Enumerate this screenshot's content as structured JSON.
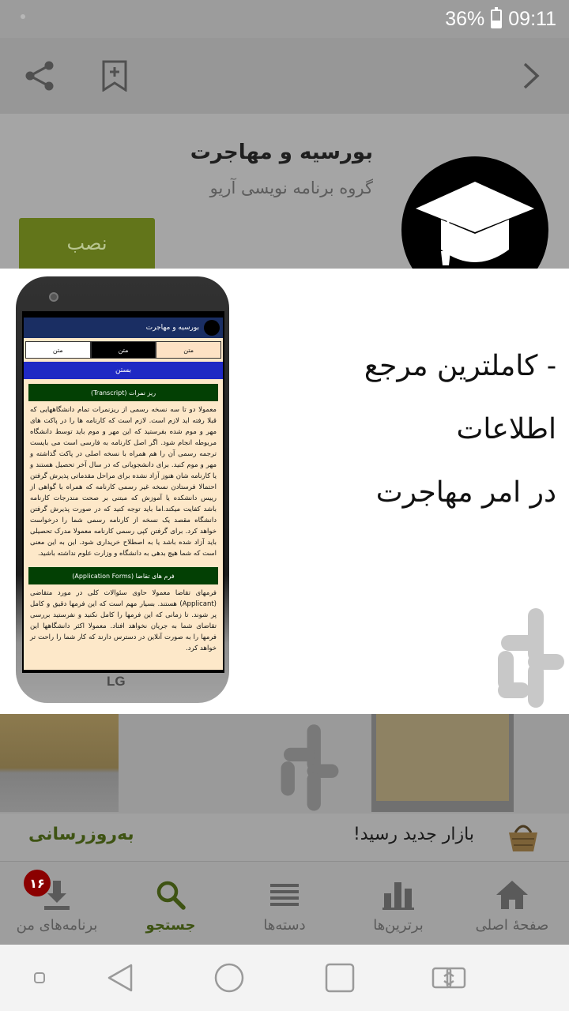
{
  "status_bar": {
    "battery": "36%",
    "time": "09:11"
  },
  "app": {
    "title": "بورسیه و مهاجرت",
    "developer": "گروه برنامه نویسی آریو",
    "install_label": "نصب"
  },
  "screenshot": {
    "caption_line1": "- کاملترین مرجع اطلاعات",
    "caption_line2": "در امر مهاجرت",
    "phone_brand": "LG",
    "inner": {
      "header_title": "بورسیه و مهاجرت",
      "tabs": [
        "متن",
        "متن",
        "متن"
      ],
      "close_label": "بستن",
      "section1_title": "ریز نمرات (Transcript)",
      "section1_text": "معمولا دو تا سه نسخه رسمی از ریزنمرات تمام دانشگاههایی که قبلا رفته اید لازم است. لازم است که کارنامه ها را در پاکت های مهر و موم شده بفرستید که این مهر و موم باید توسط دانشگاه مربوطه انجام شود. اگر اصل کارنامه به فارسی است می بایست ترجمه رسمی آن را هم همراه با نسخه اصلی در پاکت گذاشته و مهر و موم کنید. برای دانشجویانی که در سال آخر تحصیل هستند و یا کارنامه شان هنوز آزاد نشده برای مراحل مقدماتی پذیرش گرفتن احتمالا فرستادن نسخه غیر رسمی کارنامه که همراه با گواهی از رییس دانشکده یا آموزش که مبتنی بر صحت مندرجات کارنامه باشد کفایت میکند.اما باید توجه کنید که در صورت پذیرش گرفتن دانشگاه مقصد یک نسخه از کارنامه رسمی شما را درخواست خواهد کرد. برای گرفتن کپی رسمی کارنامه معمولا مدرک تحصیلی باید آزاد شده باشد یا به اصطلاح خریداری شود. این به این معنی است که شما هیچ بدهی به دانشگاه و وزارت علوم نداشته باشید.",
      "section2_title": "فرم های تقاضا (Application Forms)",
      "section2_text": "فرمهای تقاضا معمولا حاوی سئوالات کلی در مورد متقاضی (Applicant) هستند. بسیار مهم است که این فرمها دقیق و کامل پر شوند. تا زمانی که این فرمها را کامل نکنید و نفرستید بررسی تقاضای شما به جریان نخواهد افتاد. معمولا اکثر دانشگاهها این فرمها را به صورت آنلاین در دسترس دارند که کار شما را راحت تر خواهد کرد."
    }
  },
  "banner": {
    "message": "بازار جدید رسید!",
    "action": "به‌روزرسانی"
  },
  "bottom_nav": {
    "items": [
      {
        "label": "برنامه‌های من",
        "icon": "download-icon",
        "badge": "۱۶"
      },
      {
        "label": "جستجو",
        "icon": "search-icon"
      },
      {
        "label": "دسته‌ها",
        "icon": "list-icon"
      },
      {
        "label": "برترین‌ها",
        "icon": "bar-chart-icon"
      },
      {
        "label": "صفحهٔ اصلی",
        "icon": "home-icon"
      }
    ]
  },
  "colors": {
    "accent": "#62751a",
    "active_nav": "#3e5313",
    "badge": "#8b0000",
    "status_bar": "#9c9c9c"
  }
}
